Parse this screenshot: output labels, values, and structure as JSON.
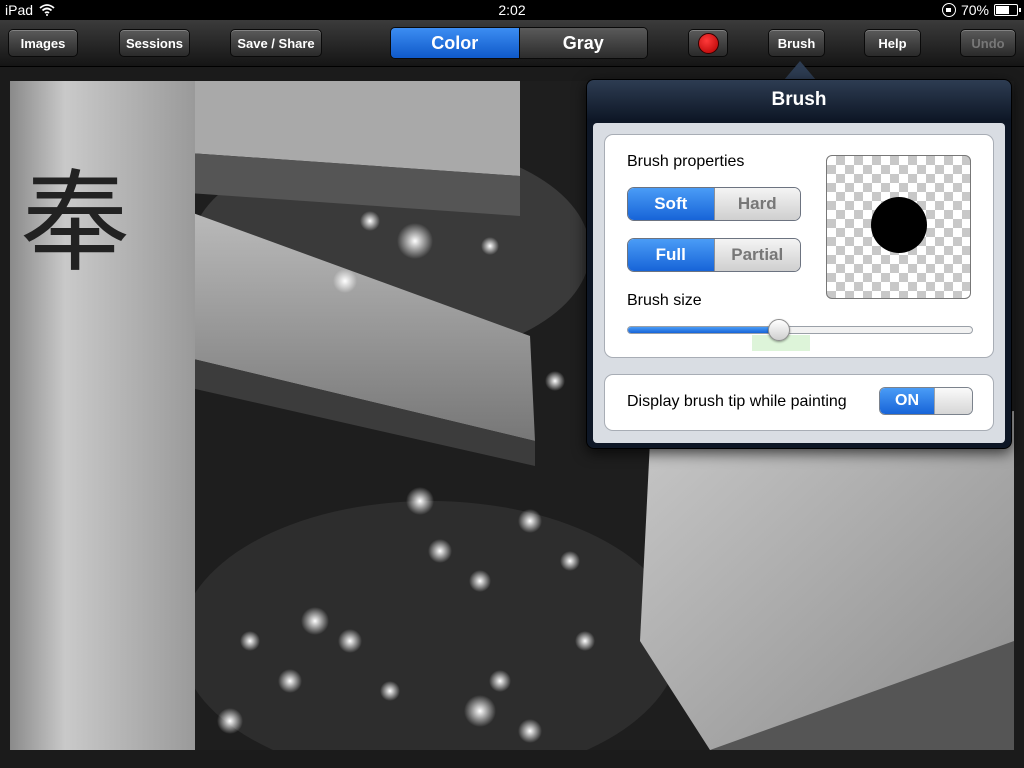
{
  "status_bar": {
    "device": "iPad",
    "time": "2:02",
    "battery": "70%",
    "battery_level": 0.7
  },
  "toolbar": {
    "images": "Images",
    "sessions": "Sessions",
    "save_share": "Save / Share",
    "mode_color": "Color",
    "mode_gray": "Gray",
    "mode_selected": "Color",
    "brush": "Brush",
    "help": "Help",
    "undo": "Undo",
    "undo_enabled": false,
    "current_color": "#d00000"
  },
  "popover": {
    "title": "Brush",
    "brush_properties_label": "Brush properties",
    "hardness_options": [
      "Soft",
      "Hard"
    ],
    "hardness_selected": "Soft",
    "coverage_options": [
      "Full",
      "Partial"
    ],
    "coverage_selected": "Full",
    "brush_size_label": "Brush size",
    "brush_size_value": 0.44,
    "display_tip_label": "Display brush tip while painting",
    "display_tip_toggle": "ON"
  },
  "colors": {
    "accent": "#1764d8",
    "toolbar_dark": "#1e1e1e",
    "popover_dark": "#0e1726"
  }
}
